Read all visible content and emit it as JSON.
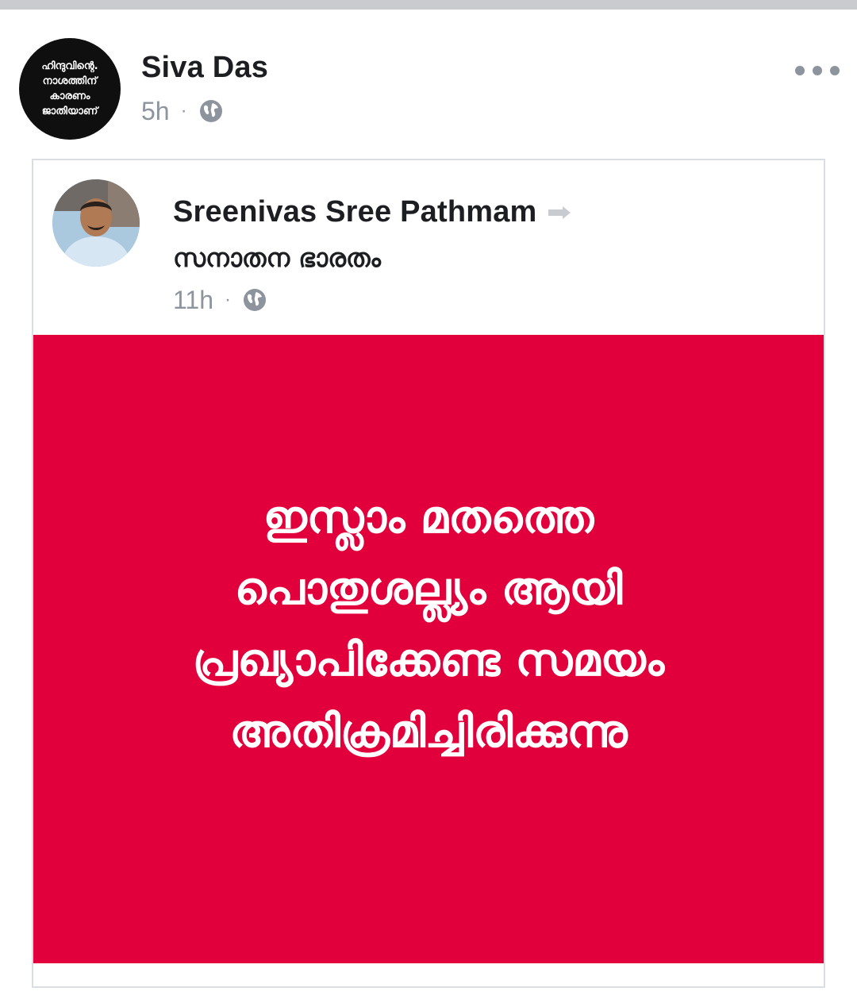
{
  "post": {
    "author_name": "Siva Das",
    "time": "5h",
    "separator": "·",
    "privacy_icon": "globe-icon",
    "more_icon": "more-horizontal-icon",
    "avatar_text": [
      "ഹിന്ദുവിന്റെ.",
      "നാശത്തിന്",
      "കാരണം",
      "ജാതിയാണ്"
    ]
  },
  "shared": {
    "author_name": "Sreenivas Sree Pathmam",
    "share_icon": "share-arrow-icon",
    "group_name": "സനാതന ഭാരതം",
    "time": "11h",
    "separator": "·",
    "privacy_icon": "globe-icon",
    "media": {
      "background": "#e2003c",
      "lines": [
        "ഇസ്ലാം മതത്തെ",
        "പൊതുശല്ല്യം ആയി",
        "പ്രഖ്യാപിക്കേണ്ട സമയം",
        "അതിക്രമിച്ചിരിക്കുന്നു"
      ]
    }
  },
  "colors": {
    "text_primary": "#1c1e21",
    "text_secondary": "#8d949e",
    "border": "#dadde1",
    "media_bg": "#e2003c"
  }
}
